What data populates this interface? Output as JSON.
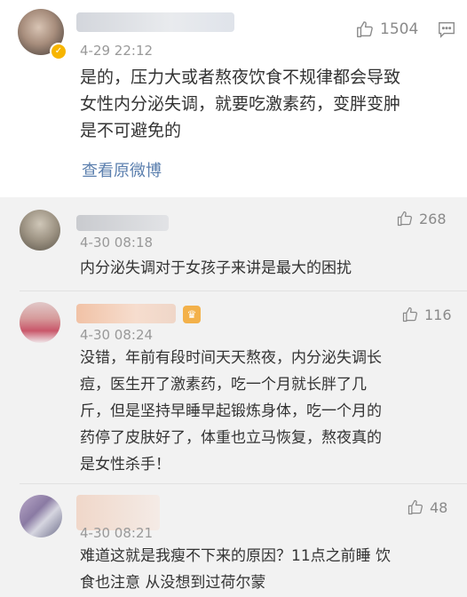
{
  "main_comment": {
    "time": "4-29 22:12",
    "likes": "1504",
    "text": "是的，压力大或者熬夜饮食不规律都会导致\n女性内分泌失调，就要吃激素药，变胖变肿\n是不可避免的",
    "view_original": "查看原微博"
  },
  "replies": [
    {
      "time": "4-30 08:18",
      "likes": "268",
      "text": "内分泌失调对于女孩子来讲是最大的困扰"
    },
    {
      "time": "4-30 08:24",
      "likes": "116",
      "text": "没错，年前有段时间天天熬夜，内分泌失调长\n痘，医生开了激素药，吃一个月就长胖了几\n斤，但是坚持早睡早起锻炼身体，吃一个月的\n药停了皮肤好了，体重也立马恢复，熬夜真的\n是女性杀手！"
    },
    {
      "time": "4-30 08:21",
      "likes": "48",
      "text": "难道这就是我瘦不下来的原因？11点之前睡 饮\n食也注意 从没想到过荷尔蒙"
    }
  ],
  "colors": {
    "link": "#5b7fae",
    "reply_bg": "#f2f2f2",
    "meta": "#999999"
  }
}
